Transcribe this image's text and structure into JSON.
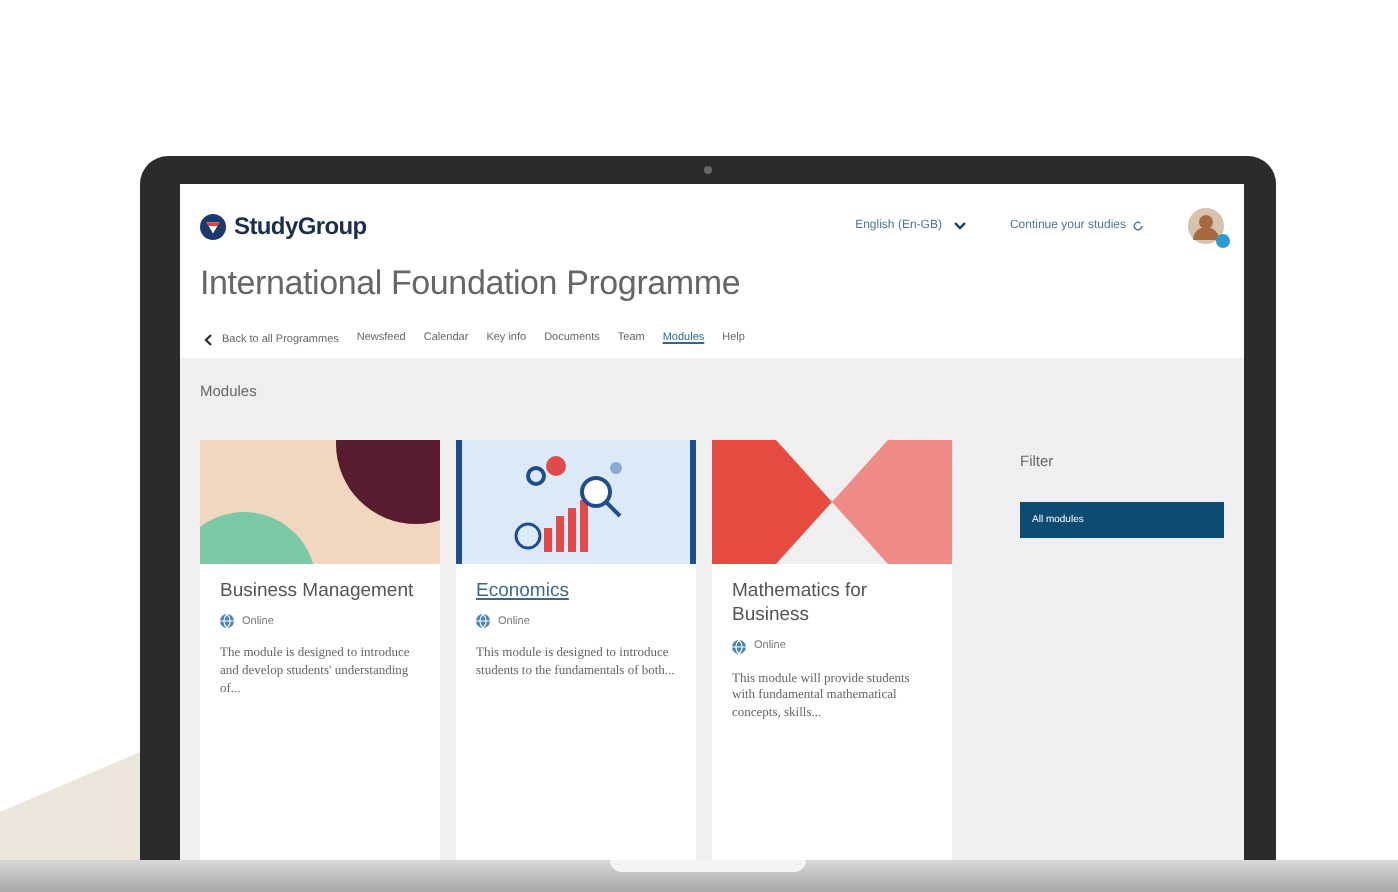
{
  "brand": {
    "name": "StudyGroup"
  },
  "header": {
    "language": "English (En-GB)",
    "continue_link": "Continue your studies"
  },
  "title": "International Foundation Programme",
  "nav": {
    "back": "Back to all Programmes",
    "tabs": [
      {
        "label": "Newsfeed",
        "selected": false
      },
      {
        "label": "Calendar",
        "selected": false
      },
      {
        "label": "Key info",
        "selected": false
      },
      {
        "label": "Documents",
        "selected": false
      },
      {
        "label": "Team",
        "selected": false
      },
      {
        "label": "Modules",
        "selected": true
      },
      {
        "label": "Help",
        "selected": false
      }
    ]
  },
  "modules": {
    "heading": "Modules",
    "cards": [
      {
        "kind": "circles",
        "title": "Business Management",
        "link": false,
        "delivery": "Online",
        "description": "The module is designed to introduce and develop students' understanding of..."
      },
      {
        "kind": "chart",
        "title": "Economics",
        "link": true,
        "delivery": "Online",
        "description": "This module is designed to introduce students to the fundamentals of both..."
      },
      {
        "kind": "bowtie",
        "title": "Mathematics for Business",
        "link": false,
        "delivery": "Online",
        "description": "This module will provide students with fundamental mathematical concepts, skills..."
      }
    ]
  },
  "filter": {
    "heading": "Filter",
    "options": [
      {
        "label": "All modules",
        "selected": true
      }
    ]
  }
}
